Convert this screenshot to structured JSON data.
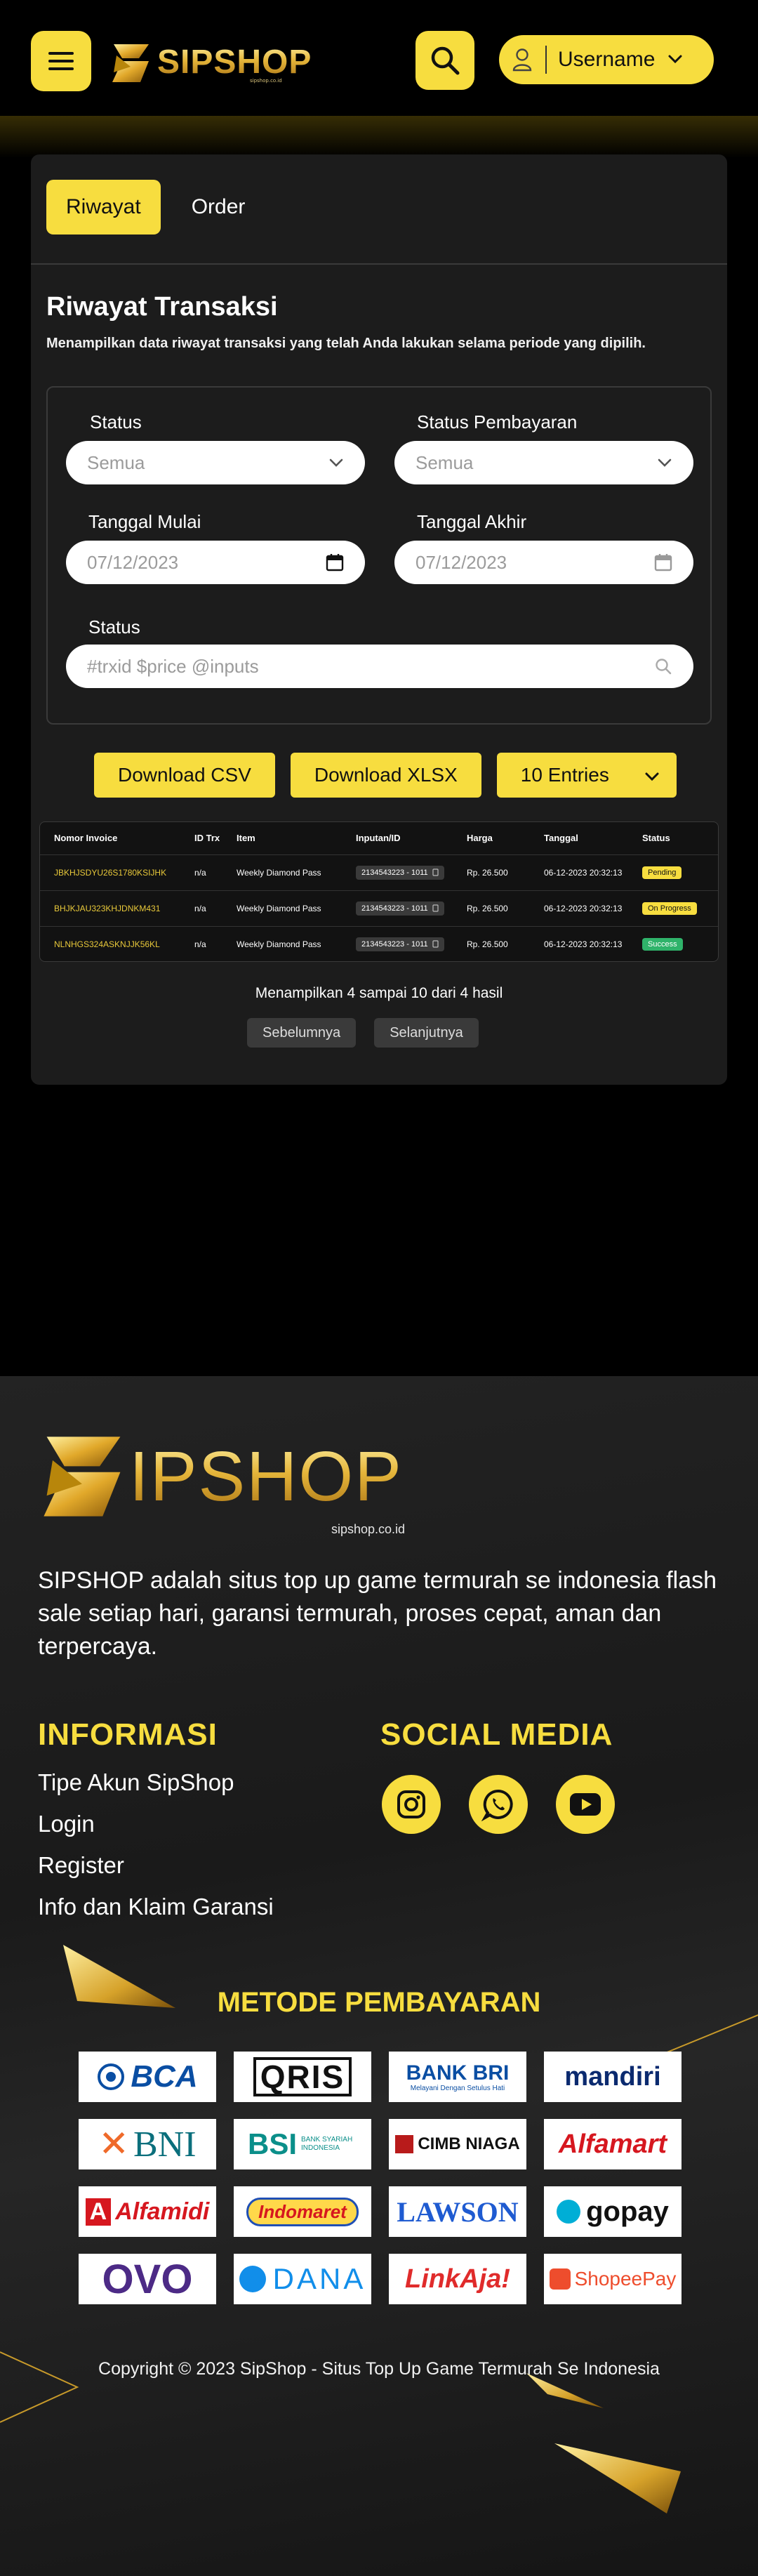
{
  "header": {
    "brand": "SIPSHOP",
    "brand_domain": "sipshop.co.id",
    "username": "Username"
  },
  "tabs": [
    {
      "label": "Riwayat",
      "active": true
    },
    {
      "label": "Order",
      "active": false
    }
  ],
  "page": {
    "title": "Riwayat Transaksi",
    "subtitle": "Menampilkan data riwayat transaksi yang telah Anda lakukan selama periode yang dipilih."
  },
  "filters": {
    "status_label": "Status",
    "status_value": "Semua",
    "payment_status_label": "Status Pembayaran",
    "payment_status_value": "Semua",
    "start_date_label": "Tanggal Mulai",
    "start_date_value": "07/12/2023",
    "end_date_label": "Tanggal Akhir",
    "end_date_value": "07/12/2023",
    "search_label": "Status",
    "search_placeholder": "#trxid $price @inputs"
  },
  "actions": {
    "download_csv": "Download CSV",
    "download_xlsx": "Download XLSX",
    "entries": "10 Entries"
  },
  "table": {
    "headers": [
      "Nomor Invoice",
      "ID Trx",
      "Item",
      "Inputan/ID",
      "Harga",
      "Tanggal",
      "Status"
    ],
    "rows": [
      {
        "invoice": "JBKHJSDYU26S1780KSIJHK",
        "trx": "n/a",
        "item": "Weekly Diamond Pass",
        "input": "2134543223 - 1011",
        "price": "Rp. 26.500",
        "date": "06-12-2023 20:32:13",
        "status": "Pending",
        "status_kind": "pending"
      },
      {
        "invoice": "BHJKJAU323KHJDNKM431",
        "trx": "n/a",
        "item": "Weekly Diamond Pass",
        "input": "2134543223 - 1011",
        "price": "Rp. 26.500",
        "date": "06-12-2023 20:32:13",
        "status": "On Progress",
        "status_kind": "progress"
      },
      {
        "invoice": "NLNHGS324ASKNJJK56KL",
        "trx": "n/a",
        "item": "Weekly Diamond Pass",
        "input": "2134543223 - 1011",
        "price": "Rp. 26.500",
        "date": "06-12-2023 20:32:13",
        "status": "Success",
        "status_kind": "success"
      }
    ]
  },
  "pagination": {
    "showing": "Menampilkan 4 sampai 10 dari 4 hasil",
    "prev": "Sebelumnya",
    "next": "Selanjutnya"
  },
  "footer": {
    "brand": "IPSHOP",
    "brand_domain": "sipshop.co.id",
    "description": "SIPSHOP adalah situs top up game termurah se indonesia flash sale setiap hari, garansi termurah, proses cepat, aman dan terpercaya.",
    "info_title": "INFORMASI",
    "info_links": [
      "Tipe Akun SipShop",
      "Login",
      "Register",
      "Info dan Klaim Garansi"
    ],
    "social_title": "SOCIAL MEDIA",
    "payment_title": "METODE PEMBAYARAN",
    "payments": [
      "BCA",
      "QRIS",
      "BANK BRI",
      "mandiri",
      "BNI",
      "BSI",
      "CIMB NIAGA",
      "Alfamart",
      "Alfamidi",
      "Indomaret",
      "LAWSON",
      "gopay",
      "OVO",
      "DANA",
      "LinkAja!",
      "ShopeePay"
    ],
    "bri_tagline": "Melayani Dengan Setulus Hati",
    "bsi_tagline": "BANK SYARIAH INDONESIA",
    "copyright": "Copyright © 2023 SipShop - Situs Top Up Game Termurah Se Indonesia"
  },
  "colors": {
    "accent": "#f7dd3f",
    "panel": "#1c1c1c",
    "success": "#2fb36a"
  },
  "icons": [
    "menu-icon",
    "search-icon",
    "user-icon",
    "chevron-down-icon",
    "calendar-icon",
    "instagram-icon",
    "whatsapp-icon",
    "youtube-icon"
  ]
}
